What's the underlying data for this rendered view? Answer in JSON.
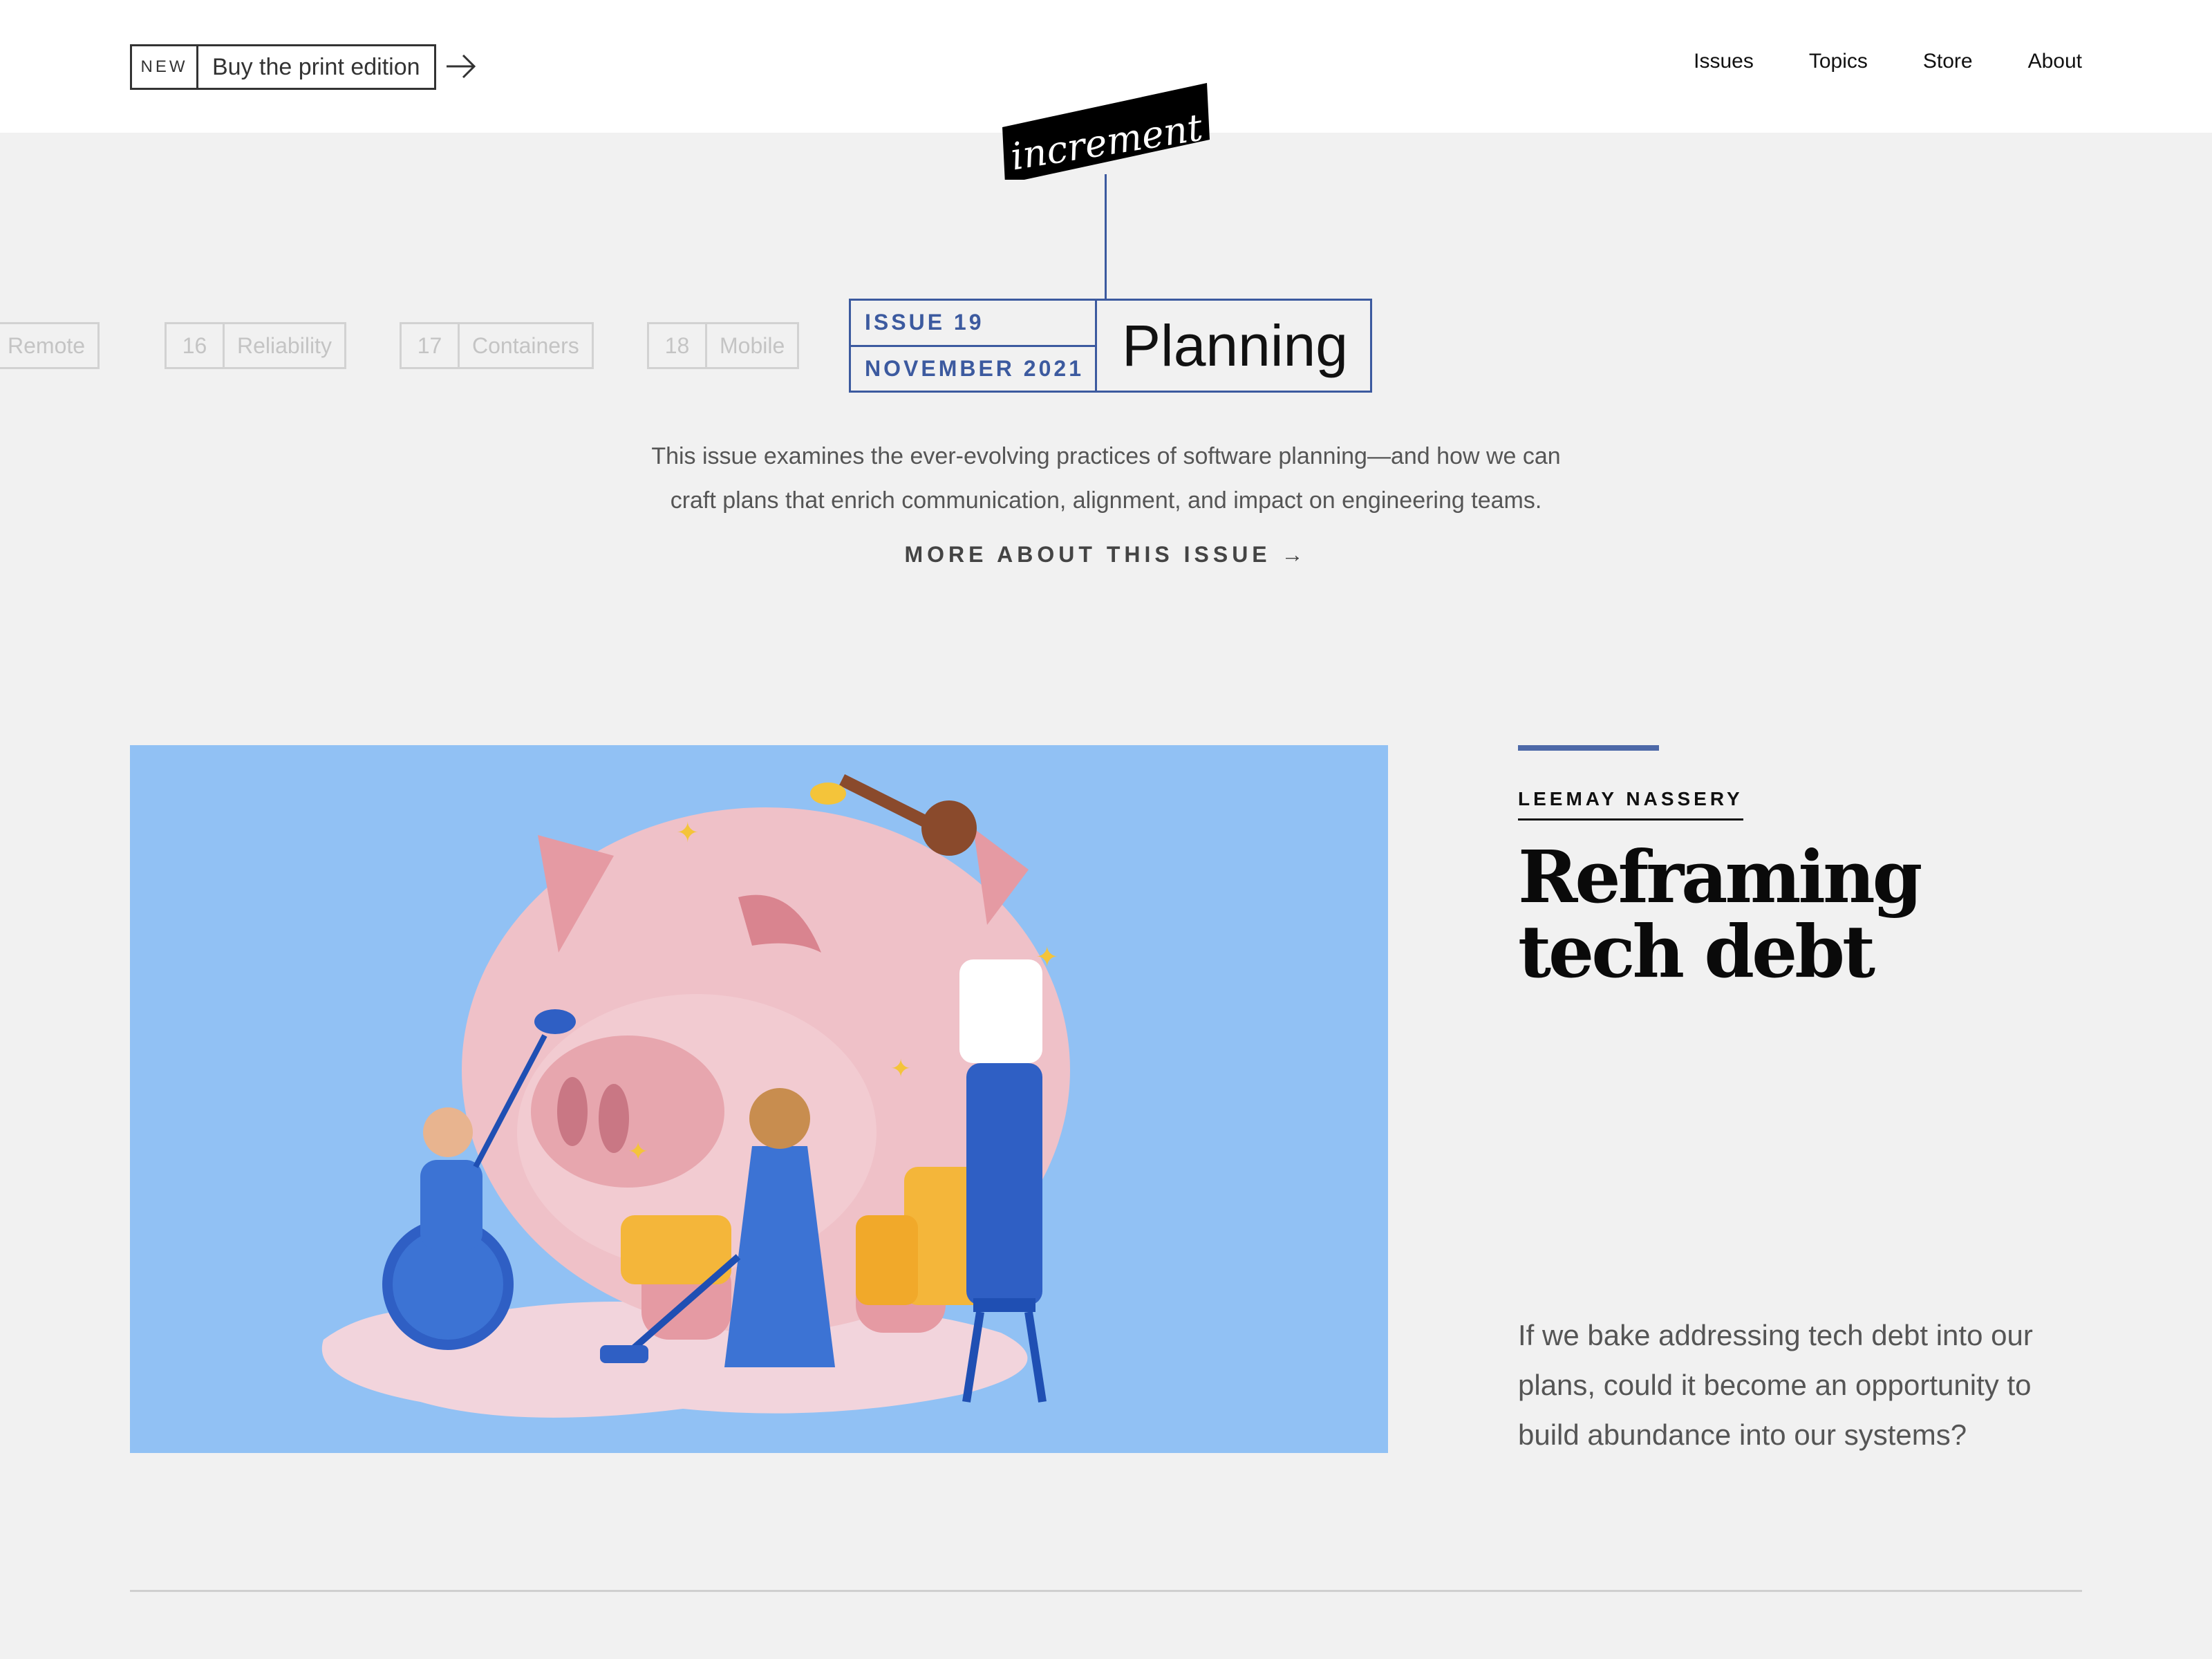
{
  "header": {
    "print_badge": "NEW",
    "print_label": "Buy the print edition",
    "nav": [
      "Issues",
      "Topics",
      "Store",
      "About"
    ]
  },
  "logo": {
    "text": "increment",
    "icon": "increment-wordmark-logo"
  },
  "issue_tabs": [
    {
      "num": "",
      "name": "Remote"
    },
    {
      "num": "16",
      "name": "Reliability"
    },
    {
      "num": "17",
      "name": "Containers"
    },
    {
      "num": "18",
      "name": "Mobile"
    }
  ],
  "current_issue": {
    "issue": "ISSUE 19",
    "date": "NOVEMBER 2021",
    "title": "Planning"
  },
  "intro": {
    "line1": "This issue examines the ever-evolving practices of software planning—and how we can",
    "line2": "craft plans that enrich communication, alignment, and impact on engineering teams.",
    "more_link": "MORE ABOUT THIS ISSUE →"
  },
  "feature": {
    "image": "piggy-bank-illustration",
    "author": "LEEMAY NASSERY",
    "headline_line1": "Reframing",
    "headline_line2": "tech debt",
    "dek": "If we bake addressing tech debt into our plans, could it become an opportunity to build abundance into our systems?"
  },
  "colors": {
    "accent": "#3c5a9f",
    "background": "#f1f1f1",
    "image_bg": "#91c1f4"
  }
}
